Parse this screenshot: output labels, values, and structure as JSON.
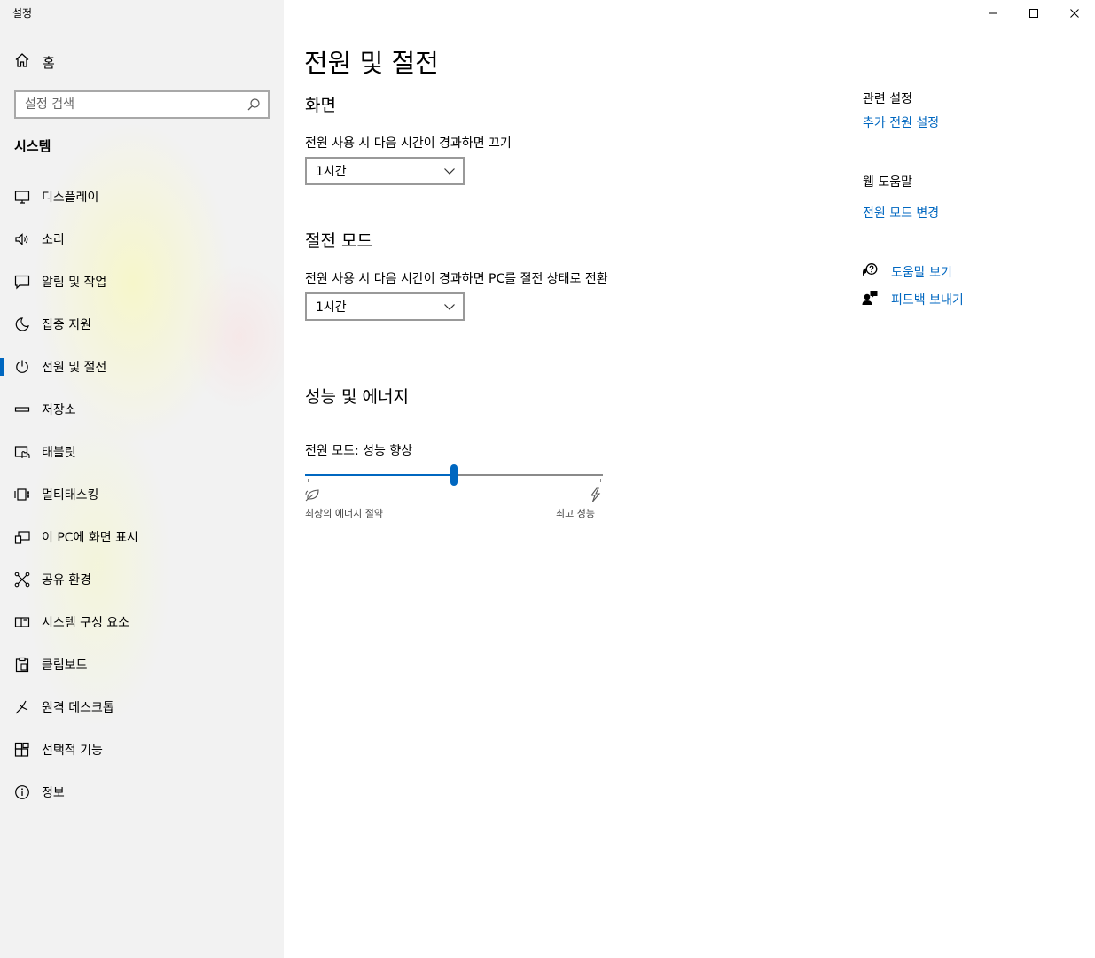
{
  "window": {
    "title": "설정"
  },
  "sidebar": {
    "home_label": "홈",
    "search_placeholder": "설정 검색",
    "section_title": "시스템",
    "items": [
      {
        "label": "디스플레이",
        "icon": "display-icon"
      },
      {
        "label": "소리",
        "icon": "speaker-icon"
      },
      {
        "label": "알림 및 작업",
        "icon": "notification-icon"
      },
      {
        "label": "집중 지원",
        "icon": "moon-icon"
      },
      {
        "label": "전원 및 절전",
        "icon": "power-icon",
        "active": true
      },
      {
        "label": "저장소",
        "icon": "storage-icon"
      },
      {
        "label": "태블릿",
        "icon": "tablet-icon"
      },
      {
        "label": "멀티태스킹",
        "icon": "multitasking-icon"
      },
      {
        "label": "이 PC에 화면 표시",
        "icon": "project-icon"
      },
      {
        "label": "공유 환경",
        "icon": "share-icon"
      },
      {
        "label": "시스템 구성 요소",
        "icon": "components-icon"
      },
      {
        "label": "클립보드",
        "icon": "clipboard-icon"
      },
      {
        "label": "원격 데스크톱",
        "icon": "remote-desktop-icon"
      },
      {
        "label": "선택적 기능",
        "icon": "optional-features-icon"
      },
      {
        "label": "정보",
        "icon": "info-icon"
      }
    ]
  },
  "main": {
    "title": "전원 및 절전",
    "screen": {
      "heading": "화면",
      "label": "전원 사용 시 다음 시간이 경과하면 끄기",
      "value": "1시간"
    },
    "sleep": {
      "heading": "절전 모드",
      "label": "전원 사용 시 다음 시간이 경과하면 PC를 절전 상태로 전환",
      "value": "1시간"
    },
    "performance": {
      "heading": "성능 및 에너지",
      "mode_label": "전원 모드: 성능 향상",
      "slider_fraction": 0.5,
      "left_caption": "최상의 에너지 절약",
      "right_caption": "최고 성능"
    }
  },
  "related": {
    "heading": "관련 설정",
    "link": "추가 전원 설정"
  },
  "help": {
    "heading": "웹 도움말",
    "link": "전원 모드 변경",
    "get_help": "도움말 보기",
    "feedback": "피드백 보내기"
  },
  "colors": {
    "accent": "#0067c0"
  }
}
